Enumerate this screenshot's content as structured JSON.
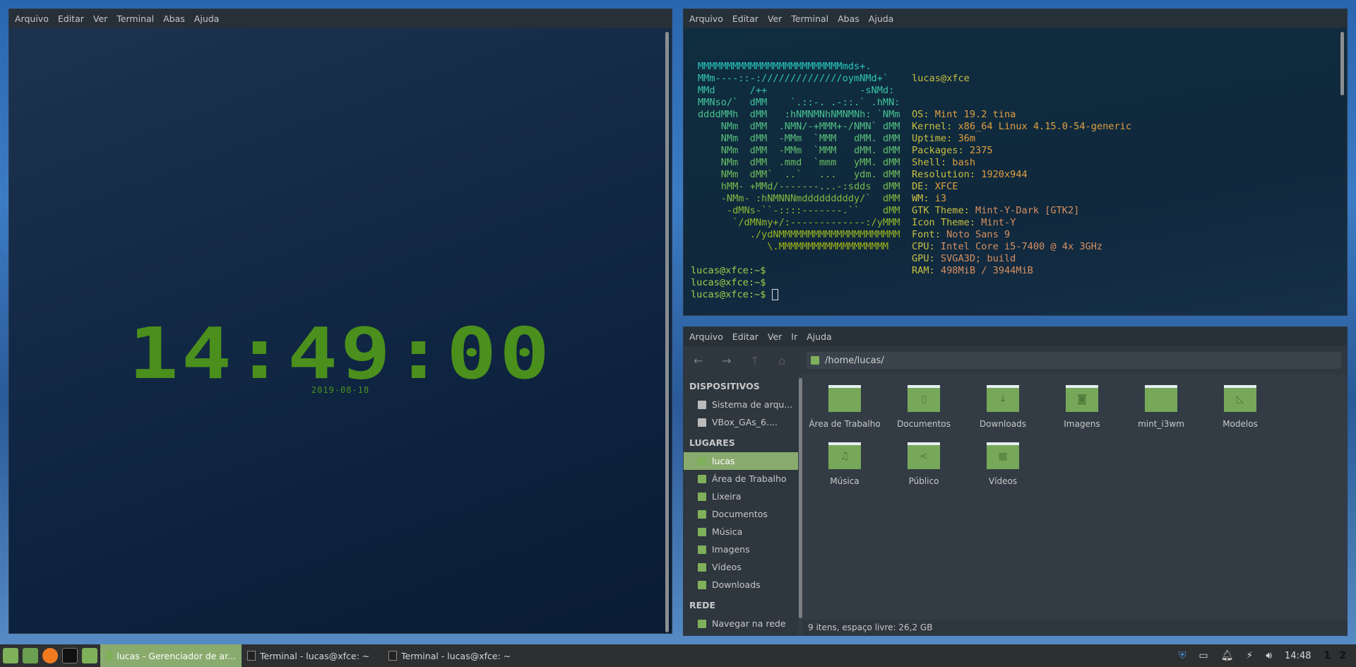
{
  "left_terminal": {
    "menu": [
      "Arquivo",
      "Editar",
      "Ver",
      "Terminal",
      "Abas",
      "Ajuda"
    ],
    "clock": "14:49:00",
    "date": "2019-08-18"
  },
  "right_terminal": {
    "menu": [
      "Arquivo",
      "Editar",
      "Ver",
      "Terminal",
      "Abas",
      "Ajuda"
    ],
    "art": [
      "MMMMMMMMMMMMMMMMMMMMMMMMMmds+.",
      "MMm----::-://////////////oymNMd+`",
      "MMd      /++                -sNMd:",
      "MMNso/`  dMM    `.::-. .-::.` .hMN:",
      "ddddMMh  dMM   :hNMNMNhNMNMNh: `NMm",
      "    NMm  dMM  .NMN/-+MMM+-/NMN` dMM",
      "    NMm  dMM  -MMm  `MMM   dMM. dMM",
      "    NMm  dMM  -MMm  `MMM   dMM. dMM",
      "    NMm  dMM  .mmd  `mmm   yMM. dMM",
      "    NMm  dMM`  ..`   ...   ydm. dMM",
      "    hMM- +MMd/-------...-:sdds  dMM",
      "    -NMm- :hNMNNNmdddddddddy/`  dMM",
      "     -dMNs-``-::::-------.``    dMM",
      "      `/dMNmy+/:-------------:/yMMM",
      "         ./ydNMMMMMMMMMMMMMMMMMMMMM",
      "            \\.MMMMMMMMMMMMMMMMMMM"
    ],
    "user_host": "lucas@xfce",
    "info": [
      {
        "k": "OS: ",
        "v": "Mint 19.2 tina"
      },
      {
        "k": "Kernel: ",
        "v": "x86_64 Linux 4.15.0-54-generic"
      },
      {
        "k": "Uptime: ",
        "v": "36m"
      },
      {
        "k": "Packages: ",
        "v": "2375"
      },
      {
        "k": "Shell: ",
        "v": "bash"
      },
      {
        "k": "Resolution: ",
        "v": "1920x944"
      },
      {
        "k": "DE: ",
        "v": "XFCE"
      },
      {
        "k": "WM: ",
        "v": "i3"
      },
      {
        "k": "GTK Theme: ",
        "v": "Mint-Y-Dark [GTK2]"
      },
      {
        "k": "Icon Theme: ",
        "v": "Mint-Y"
      },
      {
        "k": "Font: ",
        "v": "Noto Sans 9"
      },
      {
        "k": "CPU: ",
        "v": "Intel Core i5-7400 @ 4x 3GHz"
      },
      {
        "k": "GPU: ",
        "v": "SVGA3D; build"
      },
      {
        "k": "RAM: ",
        "v": "498MiB / 3944MiB"
      }
    ],
    "prompts": [
      "lucas@xfce:~$",
      "lucas@xfce:~$",
      "lucas@xfce:~$"
    ]
  },
  "file_manager": {
    "menu": [
      "Arquivo",
      "Editar",
      "Ver",
      "Ir",
      "Ajuda"
    ],
    "path": "/home/lucas/",
    "sidebar": [
      {
        "header": "DISPOSITIVOS",
        "items": [
          "Sistema de arqu...",
          "VBox_GAs_6...."
        ]
      },
      {
        "header": "LUGARES",
        "items": [
          "lucas",
          "Área de Trabalho",
          "Lixeira",
          "Documentos",
          "Música",
          "Imagens",
          "Vídeos",
          "Downloads"
        ]
      },
      {
        "header": "REDE",
        "items": [
          "Navegar na rede"
        ]
      }
    ],
    "folders": [
      {
        "name": "Área de Trabalho",
        "glyph": ""
      },
      {
        "name": "Documentos",
        "glyph": "▯"
      },
      {
        "name": "Downloads",
        "glyph": "↓"
      },
      {
        "name": "Imagens",
        "glyph": "◙"
      },
      {
        "name": "mint_i3wm",
        "glyph": ""
      },
      {
        "name": "Modelos",
        "glyph": "◺"
      },
      {
        "name": "Música",
        "glyph": "♫"
      },
      {
        "name": "Público",
        "glyph": "<"
      },
      {
        "name": "Vídeos",
        "glyph": "▦"
      }
    ],
    "status": "9 itens, espaço livre: 26,2 GB"
  },
  "taskbar": {
    "tasks": [
      "lucas - Gerenciador de ar...",
      "Terminal - lucas@xfce: ~",
      "Terminal - lucas@xfce: ~"
    ],
    "clock": "14:48",
    "workspaces": [
      "1",
      "2"
    ]
  },
  "colors": {
    "accent": "#8aab6e",
    "clock": "#4b8f1c"
  }
}
